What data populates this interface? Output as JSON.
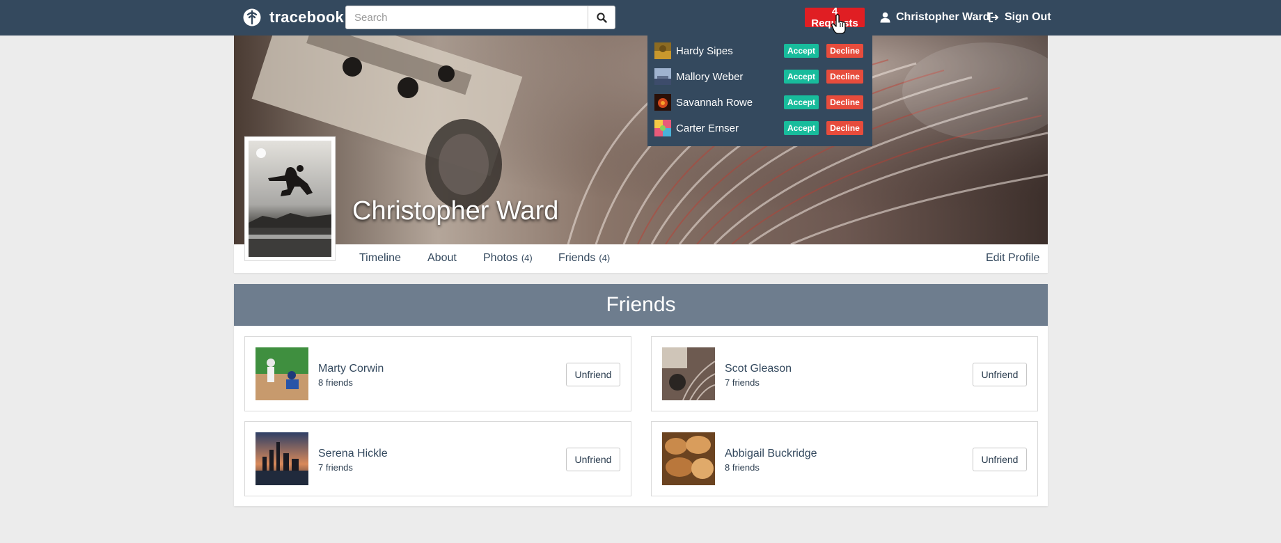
{
  "navbar": {
    "brand": "tracebook",
    "search_placeholder": "Search",
    "requests_label": "4 Requests",
    "user_label": "Christopher Ward",
    "signout_label": "Sign Out",
    "icons": [
      "brand-logo-icon",
      "search-icon",
      "user-icon",
      "sign-out-icon",
      "hand-cursor-icon"
    ]
  },
  "requests": [
    {
      "name": "Hardy Sipes",
      "accept": "Accept",
      "decline": "Decline"
    },
    {
      "name": "Mallory Weber",
      "accept": "Accept",
      "decline": "Decline"
    },
    {
      "name": "Savannah Rowe",
      "accept": "Accept",
      "decline": "Decline"
    },
    {
      "name": "Carter Ernser",
      "accept": "Accept",
      "decline": "Decline"
    }
  ],
  "profile": {
    "name": "Christopher Ward",
    "tabs": {
      "timeline": "Timeline",
      "about": "About",
      "photos": "Photos",
      "photos_count": "(4)",
      "friends": "Friends",
      "friends_count": "(4)",
      "edit": "Edit Profile"
    }
  },
  "friends_section": {
    "title": "Friends",
    "items": [
      {
        "name": "Marty Corwin",
        "count": "8 friends",
        "button": "Unfriend"
      },
      {
        "name": "Scot Gleason",
        "count": "7 friends",
        "button": "Unfriend"
      },
      {
        "name": "Serena Hickle",
        "count": "7 friends",
        "button": "Unfriend"
      },
      {
        "name": "Abbigail Buckridge",
        "count": "8 friends",
        "button": "Unfriend"
      }
    ]
  },
  "colors": {
    "navbar": "#34495e",
    "requests_badge": "#e01e23",
    "accept": "#18bc9c",
    "decline": "#e74c3c",
    "friends_header": "#6e7d8e",
    "background": "#ececec"
  }
}
